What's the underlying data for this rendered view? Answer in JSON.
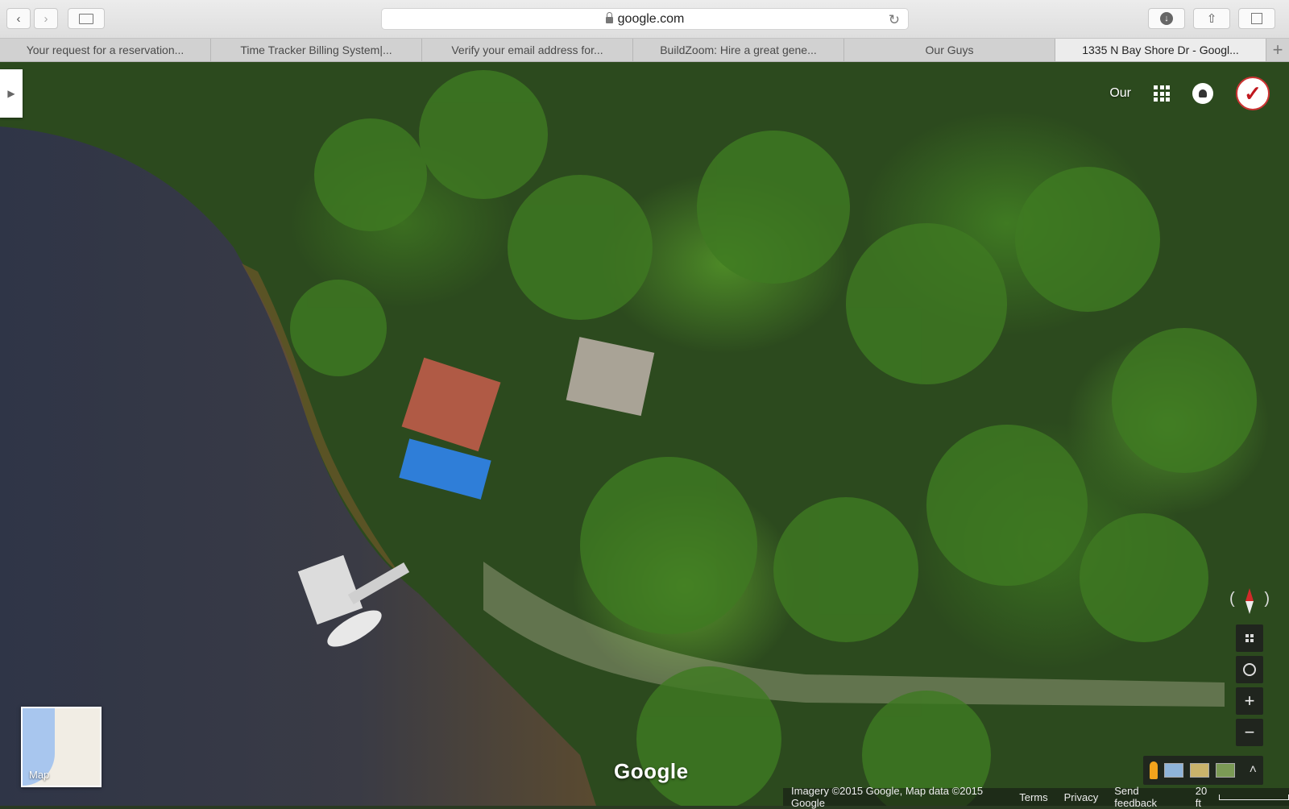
{
  "browser": {
    "url": "google.com",
    "tabs": [
      {
        "title": "Your request for a reservation..."
      },
      {
        "title": "Time Tracker Billing System|..."
      },
      {
        "title": "Verify your email address for..."
      },
      {
        "title": "BuildZoom: Hire a great gene..."
      },
      {
        "title": "Our Guys"
      },
      {
        "title": "1335 N Bay Shore Dr - Googl..."
      }
    ]
  },
  "map": {
    "account_label": "Our",
    "minimap_label": "Map",
    "logo": "Google",
    "footer": {
      "imagery": "Imagery ©2015 Google, Map data ©2015 Google",
      "terms": "Terms",
      "privacy": "Privacy",
      "feedback": "Send feedback",
      "scale": "20 ft"
    }
  },
  "icons": [
    "back-icon",
    "forward-icon",
    "sidebar-icon",
    "lock-icon",
    "reload-icon",
    "download-icon",
    "share-icon",
    "tabs-icon",
    "apps-icon",
    "notifications-icon",
    "avatar-icon",
    "compass-icon",
    "tilt-icon",
    "my-location-icon",
    "zoom-in-icon",
    "zoom-out-icon",
    "pegman-icon"
  ],
  "colors": {
    "accent_red": "#d32a2a",
    "pegman": "#f2a41c"
  }
}
